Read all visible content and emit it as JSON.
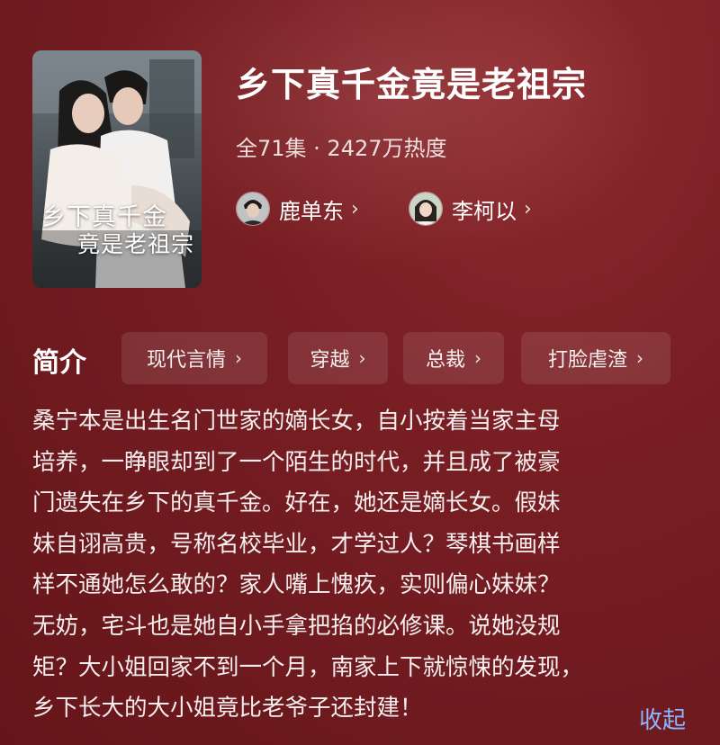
{
  "drama": {
    "poster": {
      "title_line1": "乡下真千金",
      "title_line2": "竟是老祖宗"
    },
    "title": "乡下真千金竟是老祖宗",
    "meta": "全71集 · 2427万热度",
    "actors": [
      {
        "name": "鹿单东",
        "chevron": "›"
      },
      {
        "name": "李柯以",
        "chevron": "›"
      }
    ]
  },
  "intro": {
    "label": "简介",
    "tags": [
      {
        "label": "现代言情",
        "chevron": "›"
      },
      {
        "label": "穿越",
        "chevron": "›"
      },
      {
        "label": "总裁",
        "chevron": "›"
      },
      {
        "label": "打脸虐渣",
        "chevron": "›"
      }
    ],
    "synopsis_lines": [
      "桑宁本是出生名门世家的嫡长女，自小按着当家主母",
      "培养，一睁眼却到了一个陌生的时代，并且成了被豪",
      "门遗失在乡下的真千金。好在，她还是嫡长女。假妹",
      "妹自诩高贵，号称名校毕业，才学过人？琴棋书画样",
      "样不通她怎么敢的？家人嘴上愧疚，实则偏心妹妹？",
      "无妨，宅斗也是她自小手拿把掐的必修课。说她没规",
      "矩？大小姐回家不到一个月，南家上下就惊悚的发现，",
      "乡下长大的大小姐竟比老爷子还封建！"
    ],
    "collapse_label": "收起"
  },
  "colors": {
    "background": "#7a1f24",
    "link": "#8fb4ff"
  }
}
